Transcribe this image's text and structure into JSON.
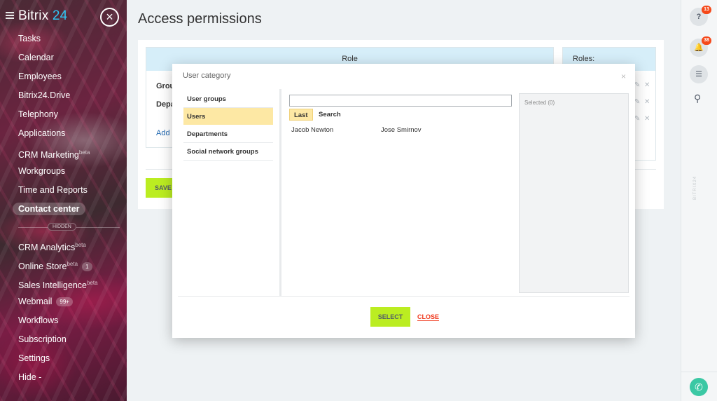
{
  "sidebar": {
    "logo_main": "Bitrix",
    "logo_num": "24",
    "items": [
      {
        "label": "Tasks"
      },
      {
        "label": "Calendar"
      },
      {
        "label": "Employees"
      },
      {
        "label": "Bitrix24.Drive"
      },
      {
        "label": "Telephony"
      },
      {
        "label": "Applications"
      },
      {
        "label": "CRM Marketing",
        "sup": "beta"
      },
      {
        "label": "Workgroups"
      },
      {
        "label": "Time and Reports"
      },
      {
        "label": "Contact center",
        "active": true
      }
    ],
    "hidden_label": "HIDDEN",
    "hidden_items": [
      {
        "label": "CRM Analytics",
        "sup": "beta"
      },
      {
        "label": "Online Store",
        "sup": "beta",
        "count": "1"
      },
      {
        "label": "Sales Intelligence",
        "sup": "beta"
      },
      {
        "label": "Webmail",
        "count": "99+"
      },
      {
        "label": "Workflows"
      },
      {
        "label": "Subscription"
      },
      {
        "label": "Settings"
      },
      {
        "label": "Hide -"
      }
    ]
  },
  "page": {
    "title": "Access permissions",
    "role_header": "Role",
    "roles_header": "Roles:",
    "row1": "Grou",
    "row2": "Depa",
    "add_link": "Add",
    "save_label": "SAVE"
  },
  "right_panel": {
    "help_badge": "13",
    "notif_badge": "38",
    "vertical_text": "BITRIX24"
  },
  "dialog": {
    "title": "User category",
    "categories": [
      "User groups",
      "Users",
      "Departments",
      "Social network groups"
    ],
    "selected_category": "Users",
    "search_value": "",
    "tabs": [
      "Last",
      "Search"
    ],
    "users": [
      "Jacob Newton",
      "Jose Smirnov"
    ],
    "selected_label": "Selected (0)",
    "select_label": "SELECT",
    "close_label": "CLOSE"
  },
  "colors": {
    "accent_green": "#bbed21",
    "link_blue": "#2067b0",
    "close_red": "#f0371b",
    "badge_red": "#f54819",
    "highlight": "#fde8a4",
    "header_blue": "#d6eef9",
    "phone_green": "#3bc8a4"
  }
}
